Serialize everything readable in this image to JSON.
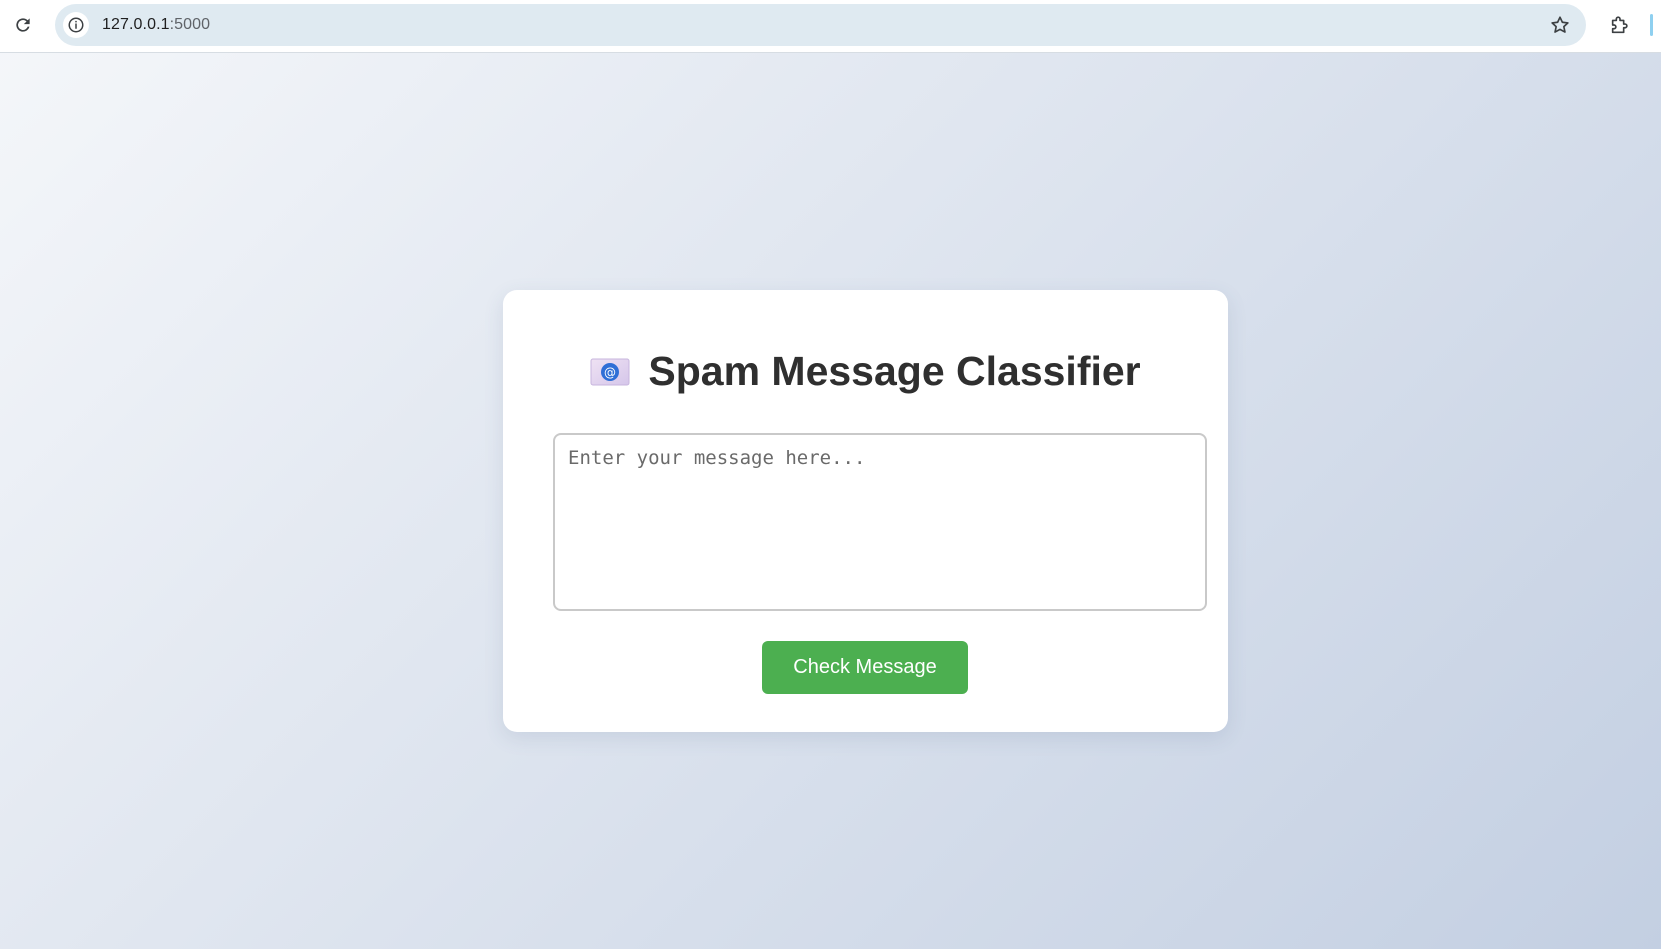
{
  "browser": {
    "url_host": "127.0.0.1",
    "url_port": ":5000",
    "icons": {
      "reload": "reload-icon",
      "site_info": "info-icon",
      "bookmark": "star-icon",
      "extensions": "puzzle-icon"
    }
  },
  "app": {
    "title": "Spam Message Classifier",
    "title_icon": "email-envelope-icon",
    "message_placeholder": "Enter your message here...",
    "message_value": "",
    "submit_label": "Check Message"
  },
  "colors": {
    "submit_button": "#4caf50",
    "title_text": "#2f2f2f",
    "omnibox": "#dfeaf1"
  }
}
